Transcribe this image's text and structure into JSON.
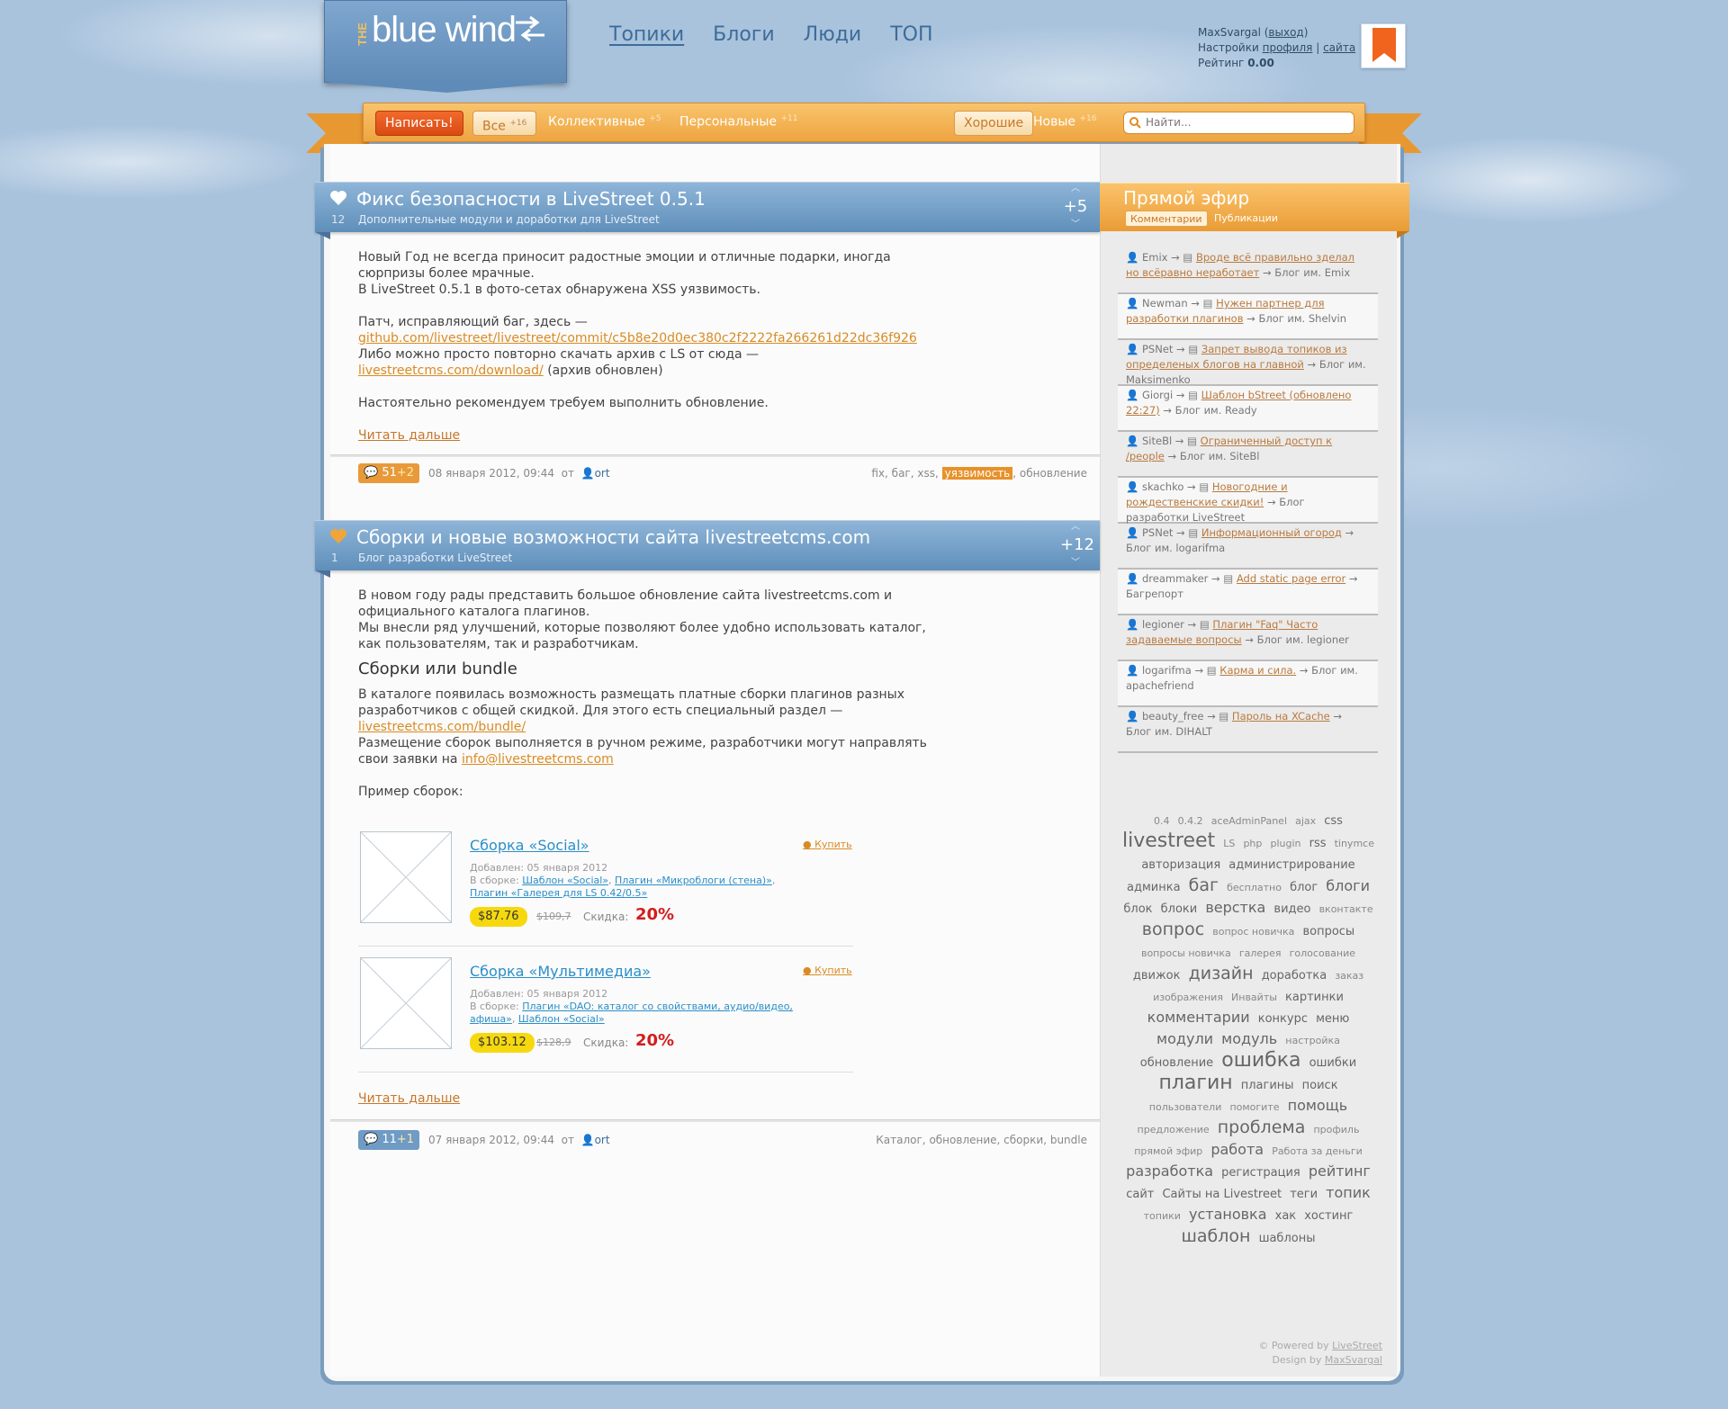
{
  "logo": {
    "the": "THE",
    "name": "blue wind"
  },
  "main_nav": [
    "Топики",
    "Блоги",
    "Люди",
    "ТОП"
  ],
  "user": {
    "name": "MaxSvargal",
    "logout": "выход",
    "settings_label": "Настройки",
    "profile": "профиля",
    "separator": "|",
    "site": "сайта",
    "rating_label": "Рейтинг",
    "rating": "0.00"
  },
  "nav": {
    "write": "Написать!",
    "all": "Все",
    "all_count": "+16",
    "collective": "Коллективные",
    "collective_count": "+5",
    "personal": "Персональные",
    "personal_count": "+11",
    "good": "Хорошие",
    "new": "Новые",
    "new_count": "+16",
    "search_placeholder": "Найти..."
  },
  "topics": [
    {
      "title": "Фикс безопасности в LiveStreet 0.5.1",
      "blog": "Дополнительные модули и доработки для LiveStreet",
      "fav": "12",
      "rating": "+5",
      "body": {
        "p1": "Новый Год не всегда приносит радостные эмоции и отличные подарки, иногда сюрпризы более мрачные.",
        "p2": "В LiveStreet 0.5.1 в фото-сетах обнаружена XSS уязвимость.",
        "p3": "Патч, исправляющий баг, здесь —",
        "link1": "github.com/livestreet/livestreet/commit/c5b8e20d0ec380c2f2222fa266261d22dc36f926",
        "p4": "Либо можно просто повторно скачать архив с LS от сюда —",
        "link2": "livestreetcms.com/download/",
        "p4_tail": "(архив обновлен)",
        "p5": "Настоятельно рекомендуем требуем выполнить обновление."
      },
      "read_more": "Читать дальше",
      "comments": "51",
      "comments_new": "+2",
      "date": "08 января 2012, 09:44",
      "from": "от",
      "author": "ort",
      "tags": [
        "fix",
        "баг",
        "xss",
        "уязвимость",
        "обновление"
      ]
    },
    {
      "title": "Сборки и новые возможности сайта livestreetcms.com",
      "blog": "Блог разработки LiveStreet",
      "fav": "1",
      "rating": "+12",
      "body": {
        "p1": "В новом году рады представить большое обновление сайта livestreetcms.com и официального каталога плагинов.",
        "p2": "Мы внесли ряд улучшений, которые позволяют более удобно использовать каталог, как пользователям, так и разработчикам.",
        "h": "Сборки или bundle",
        "p3": "В каталоге появилась возможность размещать платные сборки плагинов разных разработчиков с общей скидкой. Для этого есть специальный раздел —",
        "link1": "livestreetcms.com/bundle/",
        "p4": "Размещение сборок выполняется в ручном режиме, разработчики могут направлять свои заявки на",
        "link2": "info@livestreetcms.com",
        "p5": "Пример сборок:"
      },
      "products": [
        {
          "title": "Сборка «Social»",
          "buy": "Купить",
          "added": "Добавлен: 05 января 2012",
          "in_label": "В сборке:",
          "items": [
            "Шаблон «Social»",
            "Плагин «Микроблоги (стена)»",
            "Плагин «Галерея для LS 0.42/0.5»"
          ],
          "price": "$87.76",
          "old_price": "$109,7",
          "discount_label": "Скидка:",
          "discount": "20%"
        },
        {
          "title": "Сборка «Мультимедиа»",
          "buy": "Купить",
          "added": "Добавлен: 05 января 2012",
          "in_label": "В сборке:",
          "items": [
            "Плагин «DAO: каталог со свойствами, аудио/видео, афиша»",
            "Шаблон «Social»"
          ],
          "price": "$103.12",
          "old_price": "$128,9",
          "discount_label": "Скидка:",
          "discount": "20%"
        }
      ],
      "read_more": "Читать дальше",
      "comments": "11",
      "comments_new": "+1",
      "date": "07 января 2012, 09:44",
      "from": "от",
      "author": "ort",
      "tags": [
        "Каталог",
        "обновление",
        "сборки",
        "bundle"
      ]
    }
  ],
  "sidebar": {
    "title": "Прямой эфир",
    "tab_comments": "Комментарии",
    "tab_posts": "Публикации",
    "stream": [
      {
        "user": "Emix",
        "topic": "Вроде всё правильно зделал но всёравно нераб­отает",
        "blog": "Блог им. Emix"
      },
      {
        "user": "Newman",
        "topic": "Нужен партнер для разработки плагинов",
        "blog": "Блог им. Shelvin"
      },
      {
        "user": "PSNet",
        "topic": "Запрет вывода топиков из определеных блогов на главной",
        "blog": "Блог им. Maksimenko"
      },
      {
        "user": "Giorgi",
        "topic": "Шаблон bStreet (обновлено 22:27)",
        "blog": "Блог им. Ready"
      },
      {
        "user": "SiteBl",
        "topic": "Ограниченный доступ к /people",
        "blog": "Блог им. SiteBl"
      },
      {
        "user": "skachko",
        "topic": "Новогодние и рождественские скидки!",
        "blog": "Блог разработки LiveStreet"
      },
      {
        "user": "PSNet",
        "topic": "Информационный огород",
        "blog": "Блог им. logarifma"
      },
      {
        "user": "dreammaker",
        "topic": "Add static page error",
        "blog": "Багрепорт"
      },
      {
        "user": "legioner",
        "topic": "Плагин \"Faq\" Часто задаваемые вопросы",
        "blog": "Блог им. legioner"
      },
      {
        "user": "logarifma",
        "topic": "Карма и сила.",
        "blog": "Блог им. apachefriend"
      },
      {
        "user": "beauty_free",
        "topic": "Пароль на XCache",
        "blog": "Блог им. DIHALT"
      }
    ],
    "tags": [
      [
        "0.4",
        1
      ],
      [
        "0.4.2",
        1
      ],
      [
        "aceAdminPanel",
        1
      ],
      [
        "ajax",
        1
      ],
      [
        "css",
        2
      ],
      [
        "livestreet",
        5
      ],
      [
        "LS",
        1
      ],
      [
        "php",
        1
      ],
      [
        "plugin",
        1
      ],
      [
        "rss",
        2
      ],
      [
        "tinymce",
        1
      ],
      [
        "авторизация",
        2
      ],
      [
        "администрирование",
        2
      ],
      [
        "админка",
        2
      ],
      [
        "баг",
        4
      ],
      [
        "бесплатно",
        1
      ],
      [
        "блог",
        2
      ],
      [
        "блоги",
        3
      ],
      [
        "блок",
        2
      ],
      [
        "блоки",
        2
      ],
      [
        "верстка",
        3
      ],
      [
        "видео",
        2
      ],
      [
        "вконтакте",
        1
      ],
      [
        "вопрос",
        4
      ],
      [
        "вопрос новичка",
        1
      ],
      [
        "вопросы",
        2
      ],
      [
        "вопросы новичка",
        1
      ],
      [
        "галерея",
        1
      ],
      [
        "голосование",
        1
      ],
      [
        "движок",
        2
      ],
      [
        "дизайн",
        4
      ],
      [
        "доработка",
        2
      ],
      [
        "заказ",
        1
      ],
      [
        "изображения",
        1
      ],
      [
        "Инвайты",
        1
      ],
      [
        "картинки",
        2
      ],
      [
        "комментарии",
        3
      ],
      [
        "конкурс",
        2
      ],
      [
        "меню",
        2
      ],
      [
        "модули",
        3
      ],
      [
        "модуль",
        3
      ],
      [
        "настройка",
        1
      ],
      [
        "обновление",
        2
      ],
      [
        "ошибка",
        5
      ],
      [
        "ошибки",
        2
      ],
      [
        "плагин",
        5
      ],
      [
        "плагины",
        2
      ],
      [
        "поиск",
        2
      ],
      [
        "пользователи",
        1
      ],
      [
        "помогите",
        1
      ],
      [
        "помощь",
        3
      ],
      [
        "предложение",
        1
      ],
      [
        "проблема",
        4
      ],
      [
        "профиль",
        1
      ],
      [
        "прямой эфир",
        1
      ],
      [
        "работа",
        3
      ],
      [
        "Работа за деньги",
        1
      ],
      [
        "разработка",
        3
      ],
      [
        "регистрация",
        2
      ],
      [
        "рейтинг",
        3
      ],
      [
        "сайт",
        2
      ],
      [
        "Сайты на Livestreet",
        2
      ],
      [
        "теги",
        2
      ],
      [
        "топик",
        3
      ],
      [
        "топики",
        1
      ],
      [
        "установка",
        3
      ],
      [
        "хак",
        2
      ],
      [
        "хостинг",
        2
      ],
      [
        "шаблон",
        4
      ],
      [
        "шаблоны",
        2
      ]
    ],
    "powered_label": "© Powered by",
    "powered_link": "LiveStreet",
    "design_label": "Design by",
    "design_link": "MaxSvargal"
  }
}
